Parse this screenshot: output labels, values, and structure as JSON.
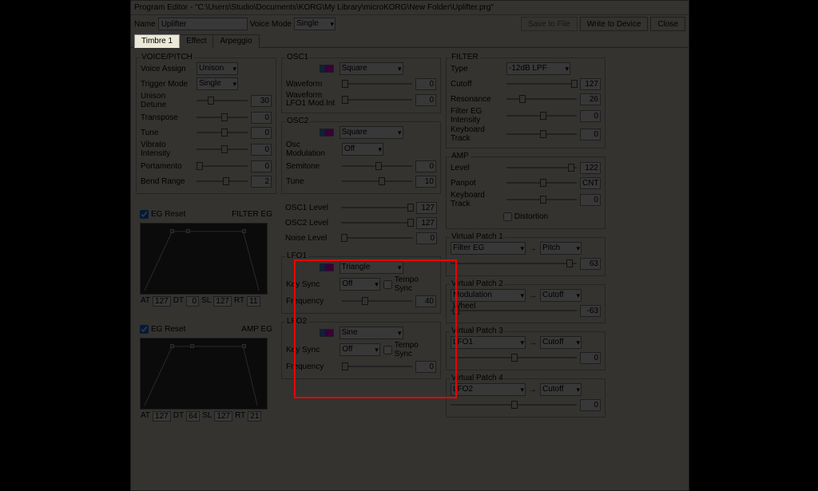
{
  "title": "Program Editor - \"C:\\Users\\Studio\\Documents\\KORG\\My Library\\microKORG\\New Folder\\Uplifter.prg\"",
  "toolbar": {
    "name_lbl": "Name",
    "name_val": "Uplifter",
    "voice_mode_lbl": "Voice Mode",
    "voice_mode_val": "Single",
    "save": "Save to File",
    "write": "Write to Device",
    "close": "Close"
  },
  "tabs": [
    "Timbre 1",
    "Effect",
    "Arpeggio"
  ],
  "voice": {
    "title": "VOICE/PITCH",
    "assign_lbl": "Voice Assign",
    "assign": "Unison",
    "trigger_lbl": "Trigger Mode",
    "trigger": "Single",
    "detune_lbl": "Unison Detune",
    "detune": "30",
    "trans_lbl": "Transpose",
    "trans": "0",
    "tune_lbl": "Tune",
    "tune": "0",
    "vib_lbl": "Vibrato Intensity",
    "vib": "0",
    "porta_lbl": "Portamento",
    "porta": "0",
    "bend_lbl": "Bend Range",
    "bend": "2"
  },
  "filter_eg": {
    "reset": "EG Reset",
    "title": "FILTER EG",
    "AT": "127",
    "DT": "0",
    "SL": "127",
    "RT": "11"
  },
  "amp_eg": {
    "reset": "EG Reset",
    "title": "AMP EG",
    "AT": "127",
    "DT": "64",
    "SL": "127",
    "RT": "21"
  },
  "osc1": {
    "title": "OSC1",
    "wave": "Square",
    "wf_lbl": "Waveform",
    "wf_val": "0",
    "lfo1_lbl": "Waveform LFO1 Mod.Int",
    "lfo1_val": "0"
  },
  "osc2": {
    "title": "OSC2",
    "wave": "Square",
    "mod_lbl": "Osc Modulation",
    "mod": "Off",
    "semi_lbl": "Semitone",
    "semi": "0",
    "tune_lbl": "Tune",
    "tune": "10"
  },
  "mixer": {
    "o1": "OSC1 Level",
    "o1v": "127",
    "o2": "OSC2 Level",
    "o2v": "127",
    "n": "Noise Level",
    "nv": "0"
  },
  "lfo1": {
    "title": "LFO1",
    "wave": "Triangle",
    "ks_lbl": "Key Sync",
    "ks": "Off",
    "ts": "Tempo Sync",
    "freq_lbl": "Frequency",
    "freq": "40"
  },
  "lfo2": {
    "title": "LFO2",
    "wave": "Sine",
    "ks_lbl": "Key Sync",
    "ks": "Off",
    "ts": "Tempo Sync",
    "freq_lbl": "Frequency",
    "freq": "0"
  },
  "filter": {
    "title": "FILTER",
    "type_lbl": "Type",
    "type": "-12dB LPF",
    "cut_lbl": "Cutoff",
    "cut": "127",
    "res_lbl": "Resonance",
    "res": "26",
    "eg_lbl": "Filter EG Intensity",
    "eg": "0",
    "kb_lbl": "Keyboard Track",
    "kb": "0"
  },
  "amp": {
    "title": "AMP",
    "lvl_lbl": "Level",
    "lvl": "122",
    "pan_lbl": "Panpot",
    "pan": "CNT",
    "kb_lbl": "Keyboard Track",
    "kb": "0",
    "dist": "Distortion"
  },
  "vp1": {
    "title": "Virtual Patch 1",
    "src": "Filter EG",
    "d": "Pitch",
    "v": "63"
  },
  "vp2": {
    "title": "Virtual Patch 2",
    "src": "Modulation Wheel",
    "d": "Cutoff",
    "v": "-63"
  },
  "vp3": {
    "title": "Virtual Patch 3",
    "src": "LFO1",
    "d": "Cutoff",
    "v": "0"
  },
  "vp4": {
    "title": "Virtual Patch 4",
    "src": "LFO2",
    "d": "Cutoff",
    "v": "0"
  },
  "labels": {
    "AT": "AT",
    "DT": "DT",
    "SL": "SL",
    "RT": "RT",
    "arrow": "→"
  }
}
